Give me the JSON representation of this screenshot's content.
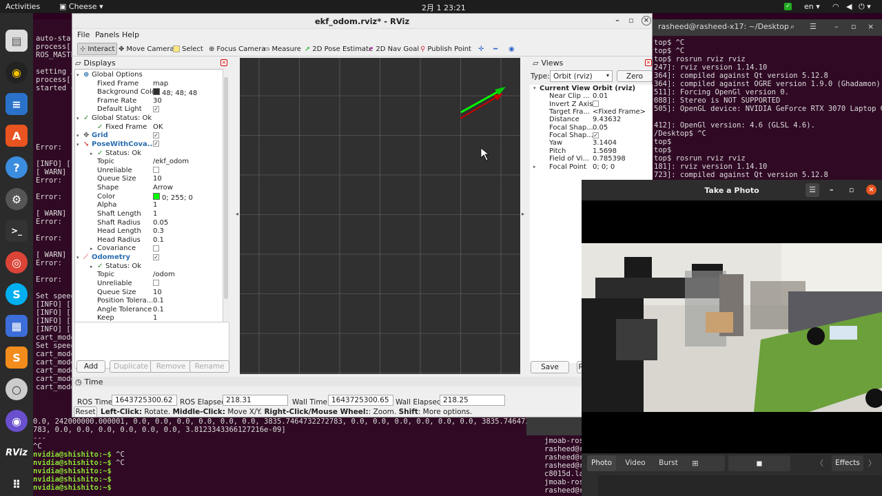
{
  "topbar": {
    "activities": "Activities",
    "app": "Cheese",
    "date": "2月 1  23:21",
    "lang": "en"
  },
  "terminal_left": {
    "lines_top": [
      "auto-star",
      "process[",
      "ROS_MASTE",
      "",
      "setting /",
      "process[",
      "started c"
    ],
    "lines_mid": [
      "",
      "Error:",
      "",
      "[INFO] [1",
      "[ WARN] [",
      "Error:",
      "",
      "Error:",
      "",
      "[ WARN] [",
      "Error:",
      "",
      "Error:",
      "",
      "[ WARN] [",
      "Error:",
      "",
      "Error:",
      "",
      "Set speed",
      "[INFO] [1",
      "[INFO] [1",
      "[INFO] [1",
      "[INFO] [1",
      "cart_mode",
      "Set speed",
      "cart_mode",
      "cart_mode",
      "cart_mode",
      "cart_mode",
      "cart_mode"
    ]
  },
  "terminal_bottom": {
    "lines": [
      "0.0, 242000000.000001, 0.0, 0.0, 0.0, 0.0, 0.0, 0.0, 3835.7464732272783, 0.0, 0.0, 0.0, 0.0, 0.0, 0.0, 3835.7464732272",
      "783, 0.0, 0.0, 0.0, 0.0, 0.0, 0.0, 3.8123343366127216e-09]",
      "---",
      "^C"
    ],
    "prompts": [
      {
        "p": "nvidia@shishito:~$",
        "c": " ^C"
      },
      {
        "p": "nvidia@shishito:~$",
        "c": " ^C"
      },
      {
        "p": "nvidia@shishito:~$",
        "c": ""
      },
      {
        "p": "nvidia@shishito:~$",
        "c": ""
      },
      {
        "p": "nvidia@shishito:~$",
        "c": " "
      }
    ]
  },
  "terminal_right": {
    "title": "rasheed@rasheed-x17: ~/Desktop",
    "lines": [
      "top$ ^C",
      "top$ ^C",
      "top$ rosrun rviz rviz",
      "247]: rviz version 1.14.10",
      "364]: compiled against Qt version 5.12.8",
      "364]: compiled against OGRE version 1.9.0 (Ghadamon)",
      "511]: Forcing OpenGl version 0.",
      "088]: Stereo is NOT SUPPORTED",
      "505]: OpenGL device: NVIDIA GeForce RTX 3070 Laptop GP",
      "",
      "412]: OpenGl version: 4.6 (GLSL 4.6).",
      "/Desktop$ ^C",
      "top$",
      "top$",
      "top$ rosrun rviz rviz",
      "181]: rviz version 1.14.10",
      "723]: compiled against Qt version 5.12.8"
    ]
  },
  "terminal_small": {
    "lines": [
      "jmoab-ros",
      "rasheed@r",
      "rasheed@r",
      "rasheed@r",
      "c8015d.la",
      "jmoab-ros",
      "rasheed@r"
    ]
  },
  "rviz": {
    "title": "ekf_odom.rviz* - RViz",
    "menu": {
      "file": "File",
      "panels": "Panels",
      "help": "Help"
    },
    "tools": {
      "interact": "Interact",
      "move_camera": "Move Camera",
      "select": "Select",
      "focus_camera": "Focus Camera",
      "measure": "Measure",
      "pose_estimate": "2D Pose Estimate",
      "nav_goal": "2D Nav Goal",
      "publish_point": "Publish Point"
    },
    "displays": {
      "title": "Displays",
      "rows": [
        {
          "k": "Global Options",
          "v": "",
          "ind": 0,
          "icon": "globe"
        },
        {
          "k": "Fixed Frame",
          "v": "map",
          "ind": 1
        },
        {
          "k": "Background Color",
          "v": "48; 48; 48",
          "ind": 1,
          "swatch": "#303030"
        },
        {
          "k": "Frame Rate",
          "v": "30",
          "ind": 1
        },
        {
          "k": "Default Light",
          "v": "✓",
          "ind": 1,
          "cb": true
        },
        {
          "k": "Global Status: Ok",
          "v": "",
          "ind": 0,
          "tick": true
        },
        {
          "k": "Fixed Frame",
          "v": "OK",
          "ind": 1,
          "tick": true
        },
        {
          "k": "Grid",
          "v": "✓",
          "ind": 0,
          "cb": true,
          "blue": true
        },
        {
          "k": "PoseWithCova...",
          "v": "✓",
          "ind": 0,
          "cb": true,
          "blue": true
        },
        {
          "k": "Status: Ok",
          "v": "",
          "ind": 1,
          "tick": true
        },
        {
          "k": "Topic",
          "v": "/ekf_odom",
          "ind": 1
        },
        {
          "k": "Unreliable",
          "v": "",
          "ind": 1,
          "cb": true
        },
        {
          "k": "Queue Size",
          "v": "10",
          "ind": 1
        },
        {
          "k": "Shape",
          "v": "Arrow",
          "ind": 1
        },
        {
          "k": "Color",
          "v": "0; 255; 0",
          "ind": 1,
          "swatch": "#00ff00"
        },
        {
          "k": "Alpha",
          "v": "1",
          "ind": 1
        },
        {
          "k": "Shaft Length",
          "v": "1",
          "ind": 1
        },
        {
          "k": "Shaft Radius",
          "v": "0.05",
          "ind": 1
        },
        {
          "k": "Head Length",
          "v": "0.3",
          "ind": 1
        },
        {
          "k": "Head Radius",
          "v": "0.1",
          "ind": 1
        },
        {
          "k": "Covariance",
          "v": "",
          "ind": 1,
          "cb": true
        },
        {
          "k": "Odometry",
          "v": "✓",
          "ind": 0,
          "cb": true,
          "blue": true
        },
        {
          "k": "Status: Ok",
          "v": "",
          "ind": 1,
          "tick": true
        },
        {
          "k": "Topic",
          "v": "/odom",
          "ind": 1
        },
        {
          "k": "Unreliable",
          "v": "",
          "ind": 1,
          "cb": true
        },
        {
          "k": "Queue Size",
          "v": "10",
          "ind": 1
        },
        {
          "k": "Position Tolera...",
          "v": "0.1",
          "ind": 1
        },
        {
          "k": "Angle Tolerance",
          "v": "0.1",
          "ind": 1
        },
        {
          "k": "Keep",
          "v": "1",
          "ind": 1
        }
      ],
      "buttons": {
        "add": "Add",
        "duplicate": "Duplicate",
        "remove": "Remove",
        "rename": "Rename"
      }
    },
    "views": {
      "title": "Views",
      "type_label": "Type:",
      "type_value": "Orbit (rviz)",
      "zero": "Zero",
      "rows": [
        {
          "k": "Current View",
          "v": "Orbit (rviz)",
          "bold": true
        },
        {
          "k": "Near Clip ...",
          "v": "0.01"
        },
        {
          "k": "Invert Z Axis",
          "v": "",
          "cb": true
        },
        {
          "k": "Target Fra...",
          "v": "<Fixed Frame>"
        },
        {
          "k": "Distance",
          "v": "9.43632"
        },
        {
          "k": "Focal Shap...",
          "v": "0.05"
        },
        {
          "k": "Focal Shap...",
          "v": "✓",
          "cb": true
        },
        {
          "k": "Yaw",
          "v": "3.1404"
        },
        {
          "k": "Pitch",
          "v": "1.5698"
        },
        {
          "k": "Field of Vi...",
          "v": "0.785398"
        },
        {
          "k": "Focal Point",
          "v": "0; 0; 0"
        }
      ],
      "save": "Save"
    },
    "time": {
      "title": "Time",
      "ros_time_label": "ROS Time:",
      "ros_time": "1643725300.62",
      "ros_elapsed_label": "ROS Elapsed:",
      "ros_elapsed": "218.31",
      "wall_time_label": "Wall Time:",
      "wall_time": "1643725300.65",
      "wall_elapsed_label": "Wall Elapsed:",
      "wall_elapsed": "218.25"
    },
    "status": {
      "reset": "Reset",
      "lc": "Left-Click:",
      "lc_t": " Rotate. ",
      "mc": "Middle-Click:",
      "mc_t": " Move X/Y. ",
      "rc": "Right-Click/Mouse Wheel:",
      "rc_t": ": Zoom. ",
      "sh": "Shift",
      "sh_t": ": More options."
    }
  },
  "cheese": {
    "title": "Take a Photo",
    "modes": {
      "photo": "Photo",
      "video": "Video",
      "burst": "Burst"
    },
    "effects": "Effects"
  }
}
